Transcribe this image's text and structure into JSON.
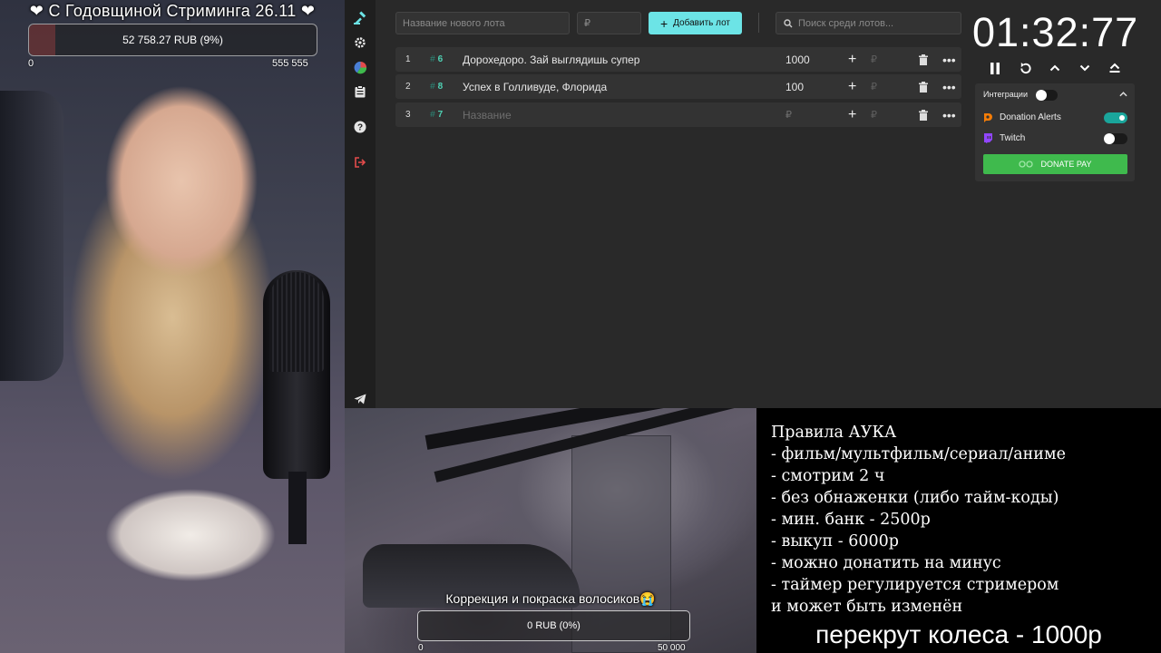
{
  "stream": {
    "title": "❤ С Годовщиной Стриминга 26.11 ❤",
    "goal": {
      "text": "52 758.27 RUB (9%)",
      "min": "0",
      "max": "555 555",
      "progress": 0.09
    }
  },
  "app": {
    "sidebar": [
      "gavel-icon",
      "settings-icon",
      "stats-icon",
      "clipboard-icon",
      "help-icon",
      "logout-icon",
      "telegram-icon"
    ],
    "new_lot_placeholder": "Название нового лота",
    "price_placeholder": "₽",
    "add_button": "Добавить лот",
    "search_placeholder": "Поиск среди лотов...",
    "currency": "₽",
    "lots": [
      {
        "num": "1",
        "id": "6",
        "name": "Дорохедоро.  Зай выглядишь супер",
        "amount": "1000"
      },
      {
        "num": "2",
        "id": "8",
        "name": "Успех в Голливуде, Флорида",
        "amount": "100"
      },
      {
        "num": "3",
        "id": "7",
        "name": "",
        "name_placeholder": "Название",
        "amount": "",
        "amount_placeholder": "₽"
      }
    ]
  },
  "timer": {
    "value": "01:32:77"
  },
  "integrations": {
    "title": "Интеграции",
    "items": [
      {
        "name": "Donation Alerts",
        "enabled": true
      },
      {
        "name": "Twitch",
        "enabled": false
      }
    ],
    "donate_pay": "DONATE PAY"
  },
  "goal2": {
    "title": "Коррекция и покраска волосиков😭",
    "text": "0 RUB (0%)",
    "min": "0",
    "max": "50 000"
  },
  "rules": {
    "lines": [
      "Правила АУКА",
      "- фильм/мультфильм/сериал/аниме",
      "- смотрим 2 ч",
      "- без обнаженки (либо тайм-коды)",
      "- мин. банк - 2500р",
      "- выкуп - 6000р",
      "- можно донатить на минус",
      "- таймер регулируется стримером",
      "и может быть изменён"
    ],
    "footer": "перекрут колеса - 1000р"
  }
}
